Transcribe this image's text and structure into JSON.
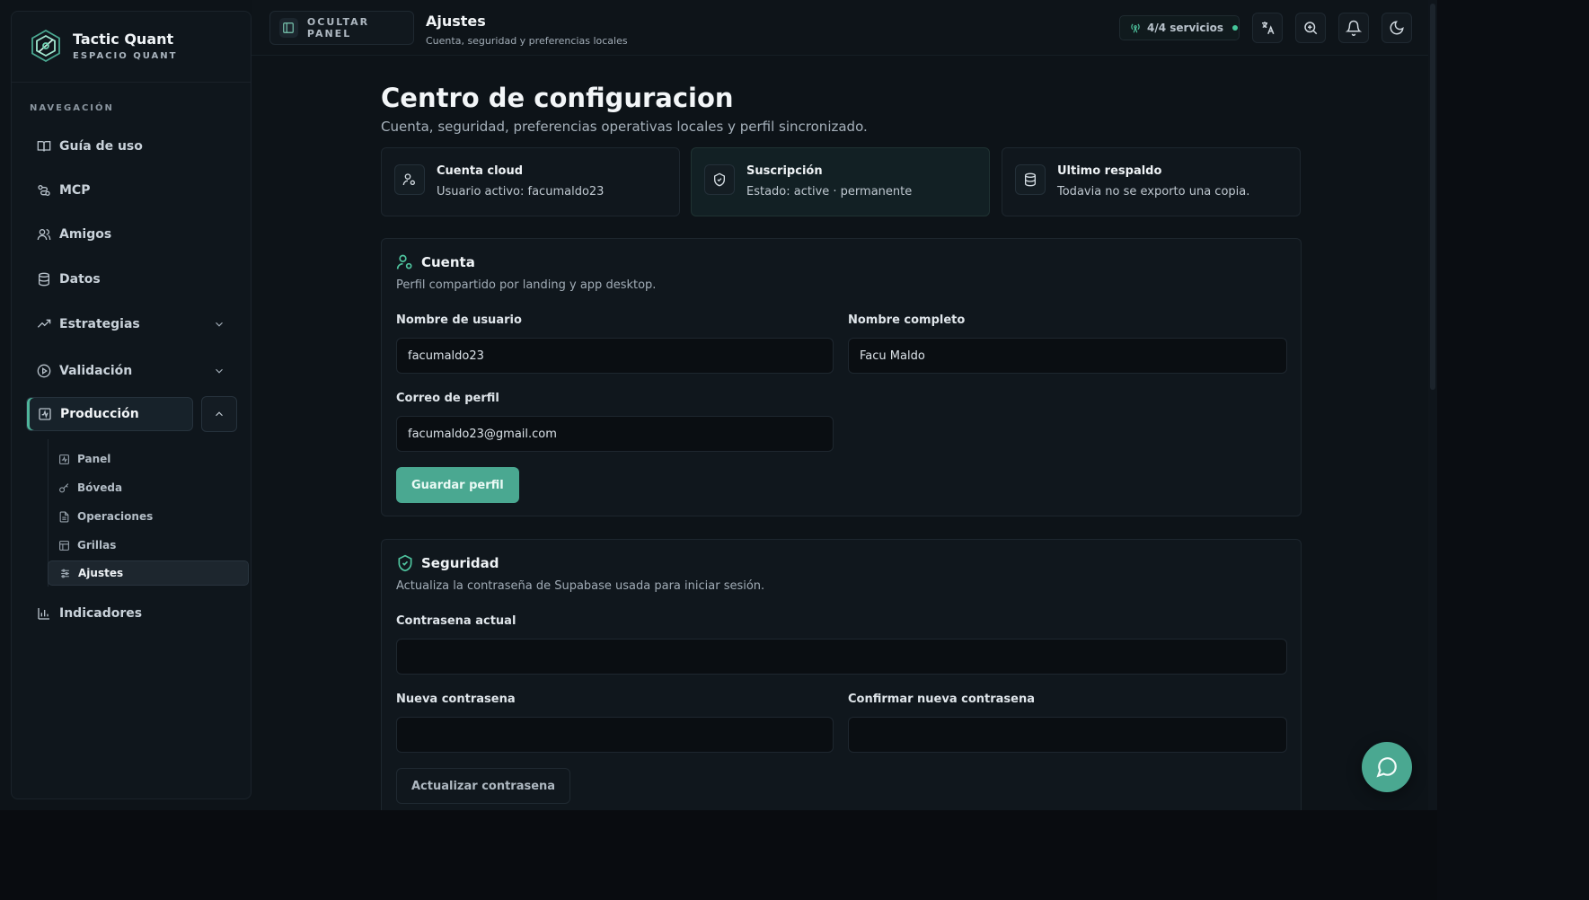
{
  "brand": {
    "title": "Tactic Quant",
    "subtitle": "ESPACIO QUANT"
  },
  "sidebar": {
    "heading": "NAVEGACIÓN",
    "items": [
      {
        "label": "Guía de uso",
        "icon": "book-icon"
      },
      {
        "label": "MCP",
        "icon": "route-icon"
      },
      {
        "label": "Amigos",
        "icon": "users-icon"
      },
      {
        "label": "Datos",
        "icon": "database-icon"
      },
      {
        "label": "Estrategias",
        "icon": "trending-up-icon"
      },
      {
        "label": "Validación",
        "icon": "play-circle-icon"
      },
      {
        "label": "Producción",
        "icon": "activity-square-icon"
      },
      {
        "label": "Indicadores",
        "icon": "bar-chart-icon"
      }
    ],
    "sub_items": [
      {
        "label": "Panel"
      },
      {
        "label": "Bóveda"
      },
      {
        "label": "Operaciones"
      },
      {
        "label": "Grillas"
      },
      {
        "label": "Ajustes"
      }
    ]
  },
  "topbar": {
    "hide_panel": "OCULTAR PANEL",
    "title": "Ajustes",
    "subtitle": "Cuenta, seguridad y preferencias locales",
    "services": "4/4 servicios"
  },
  "main": {
    "title": "Centro de configuracion",
    "subtitle": "Cuenta, seguridad, preferencias operativas locales y perfil sincronizado."
  },
  "stats": [
    {
      "title": "Cuenta cloud",
      "value": "Usuario activo: facumaldo23"
    },
    {
      "title": "Suscripción",
      "value": "Estado: active · permanente"
    },
    {
      "title": "Ultimo respaldo",
      "value": "Todavia no se exporto una copia."
    }
  ],
  "account": {
    "title": "Cuenta",
    "subtitle": "Perfil compartido por landing y app desktop.",
    "username_label": "Nombre de usuario",
    "username_value": "facumaldo23",
    "fullname_label": "Nombre completo",
    "fullname_value": "Facu Maldo",
    "email_label": "Correo de perfil",
    "email_value": "facumaldo23@gmail.com",
    "save_label": "Guardar perfil"
  },
  "security": {
    "title": "Seguridad",
    "subtitle": "Actualiza la contraseña de Supabase usada para iniciar sesión.",
    "current_label": "Contrasena actual",
    "new_label": "Nueva contrasena",
    "confirm_label": "Confirmar nueva contrasena",
    "update_label": "Actualizar contrasena"
  },
  "colors": {
    "accent": "#4aa891",
    "background": "#0d1318",
    "panel": "#10171d"
  }
}
